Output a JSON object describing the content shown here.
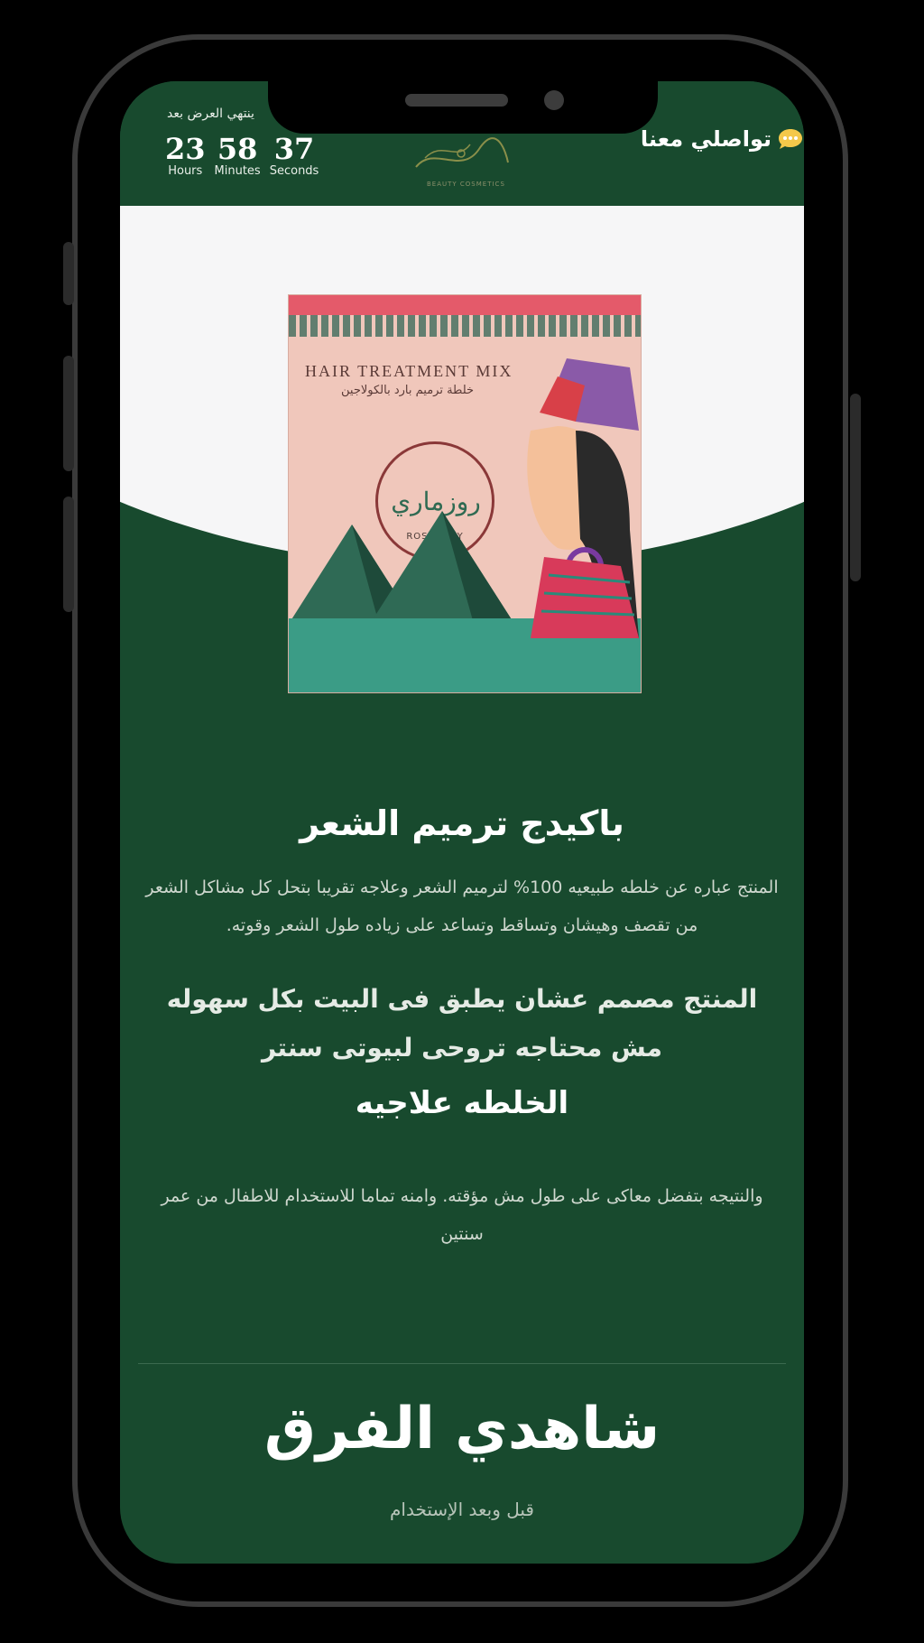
{
  "header": {
    "countdown_label": "ينتهي العرض بعد",
    "countdown": [
      {
        "value": "23",
        "unit": "Hours"
      },
      {
        "value": "58",
        "unit": "Minutes"
      },
      {
        "value": "37",
        "unit": "Seconds"
      }
    ],
    "logo_subtitle": "BEAUTY COSMETICS",
    "contact_label": "تواصلي معنا",
    "contact_icon": "chat-bubble-icon"
  },
  "product_image": {
    "title_en": "HAIR TREATMENT MIX",
    "title_ar": "خلطة ترميم بارد بالكولاجين",
    "brand_ar": "روزماري",
    "brand_en": "ROSEMARY"
  },
  "content": {
    "title": "باكيدج ترميم الشعر",
    "description": "المنتج عباره عن خلطه طبيعيه 100% لترميم الشعر وعلاجه تقريبا بتحل كل مشاكل الشعر من تقصف وهيشان وتساقط وتساعد على زياده طول الشعر وقوته.",
    "subtitle": "المنتج مصمم عشان يطبق فى البيت بكل سهوله مش محتاجه تروحى لبيوتى سنتر",
    "mix_title": "الخلطه علاجيه",
    "result": "والنتيجه بتفضل معاكى على طول مش مؤقته. وامنه تماما للاستخدام للاطفال من عمر سنتين"
  },
  "comparison": {
    "title": "شاهدي الفرق",
    "subtitle": "قبل وبعد الإستخدام"
  },
  "colors": {
    "primary_green": "#184a2e",
    "hero_white": "#f6f6f7"
  }
}
